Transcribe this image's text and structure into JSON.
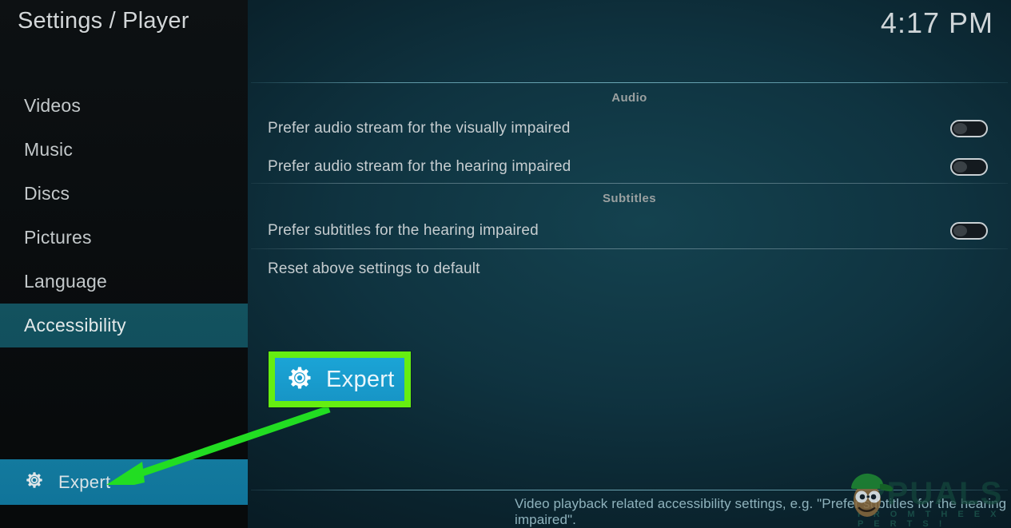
{
  "header": {
    "title": "Settings / Player",
    "clock": "4:17 PM"
  },
  "sidebar": {
    "items": [
      {
        "label": "Videos",
        "active": false
      },
      {
        "label": "Music",
        "active": false
      },
      {
        "label": "Discs",
        "active": false
      },
      {
        "label": "Pictures",
        "active": false
      },
      {
        "label": "Language",
        "active": false
      },
      {
        "label": "Accessibility",
        "active": true
      }
    ],
    "level_button": {
      "label": "Expert",
      "icon": "gear-icon"
    }
  },
  "main": {
    "sections": [
      {
        "header": "Audio",
        "rows": [
          {
            "label": "Prefer audio stream for the visually impaired",
            "control": "toggle",
            "value": "off"
          },
          {
            "label": "Prefer audio stream for the hearing impaired",
            "control": "toggle",
            "value": "off"
          }
        ]
      },
      {
        "header": "Subtitles",
        "rows": [
          {
            "label": "Prefer subtitles for the hearing impaired",
            "control": "toggle",
            "value": "off"
          },
          {
            "label": "Reset above settings to default",
            "control": "none",
            "value": ""
          }
        ]
      }
    ],
    "footer_description": "Video playback related accessibility settings, e.g. \"Prefer subtitles for the hearing impaired\"."
  },
  "callout": {
    "label": "Expert",
    "icon": "gear-icon",
    "border_color": "#66ee11",
    "fill_color": "#1ba4d6",
    "arrow_color": "#22dd22"
  },
  "watermark": {
    "brand": "PPUALS",
    "tagline": "F R O M   T H E   E X P E R T S !"
  },
  "colors": {
    "sidebar_bg": "#0a0d0f",
    "content_bg": "#0f3340",
    "accent_teal": "#12505d",
    "accent_blue": "#12769c",
    "text_primary": "#c6cdd0",
    "text_muted": "#9aa0a0",
    "footer_text": "#8fb3bd"
  }
}
